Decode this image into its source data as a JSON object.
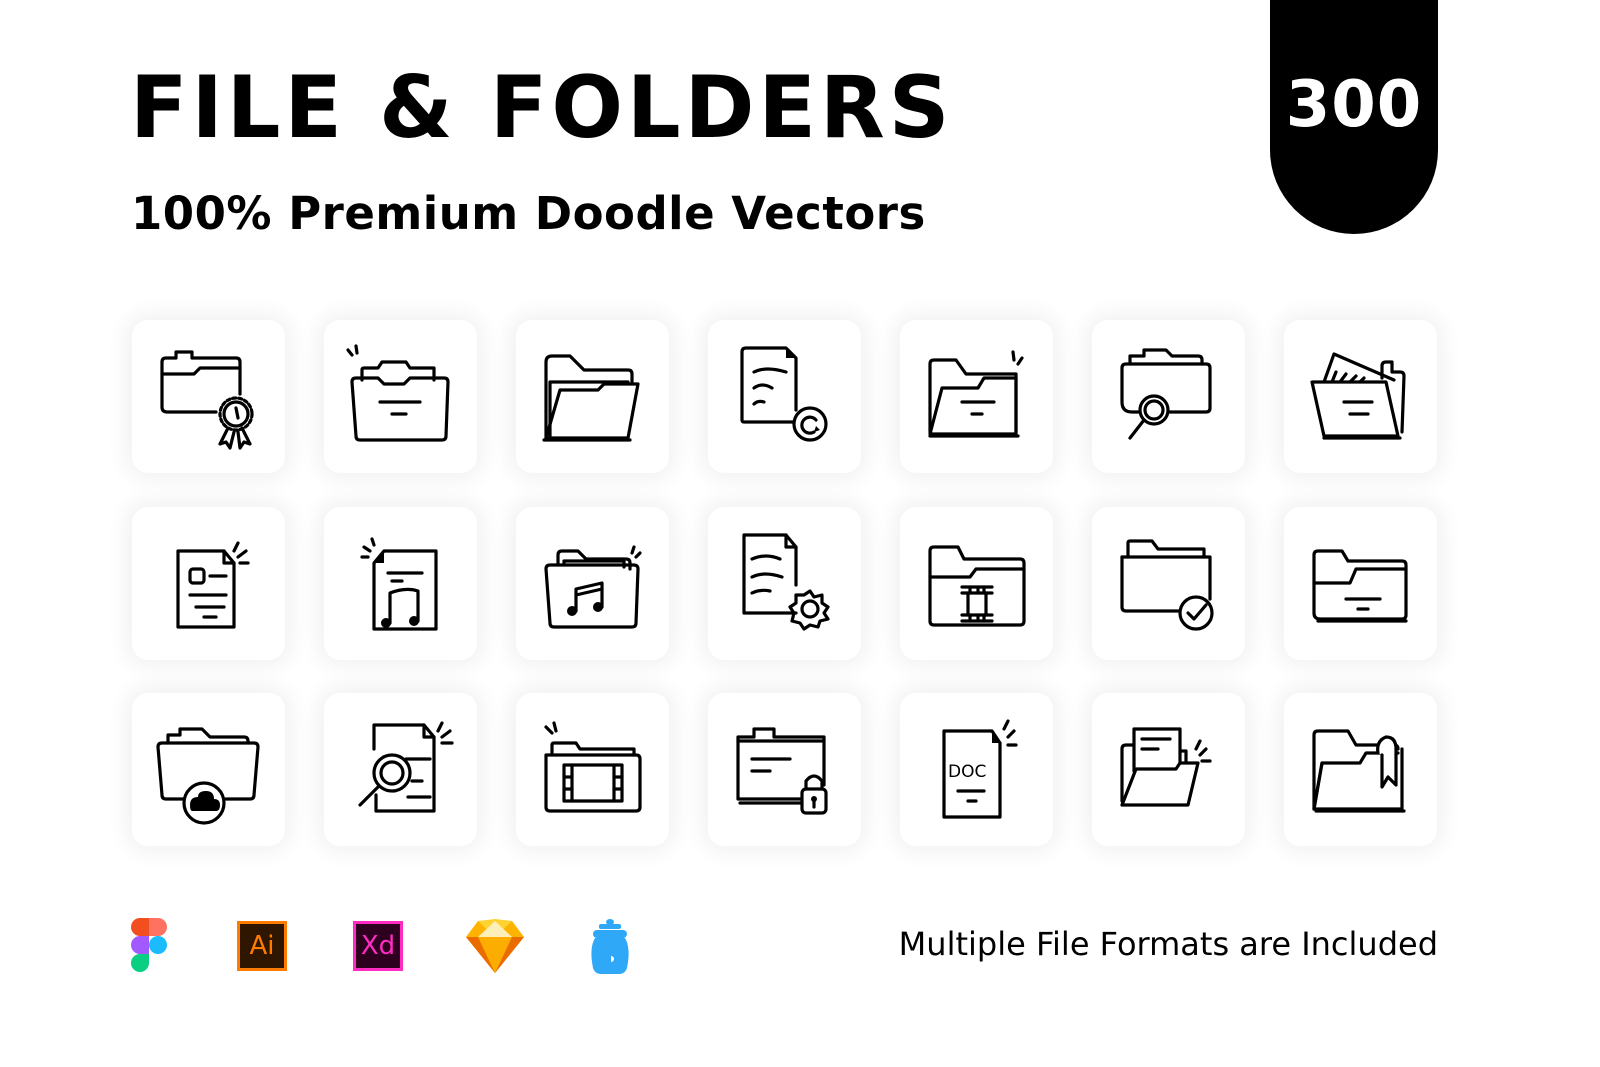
{
  "header": {
    "title": "FILE & FOLDERS",
    "subtitle": "100% Premium Doodle Vectors",
    "count_badge": "300"
  },
  "icon_grid": {
    "columns": 7,
    "rows": 3,
    "icons": [
      "folder-certificate-icon",
      "folder-open-files-icon",
      "folder-open-icon",
      "document-refresh-icon",
      "folder-open-new-icon",
      "folder-search-icon",
      "folder-open-documents-icon",
      "document-new-icon",
      "document-music-icon",
      "folder-music-icon",
      "document-settings-icon",
      "folder-film-icon",
      "folder-check-icon",
      "folder-icon",
      "folder-cloud-icon",
      "document-search-icon",
      "folder-video-icon",
      "folder-lock-icon",
      "document-doc-icon",
      "folder-documents-icon",
      "folder-bookmark-icon"
    ],
    "doc_label": "DOC"
  },
  "footer": {
    "formats": [
      {
        "name": "figma-icon",
        "label": ""
      },
      {
        "name": "illustrator-icon",
        "label": "Ai",
        "bg": "#2e1600",
        "accent": "#ff7c00"
      },
      {
        "name": "xd-icon",
        "label": "Xd",
        "bg": "#2e001f",
        "accent": "#ff2bc2"
      },
      {
        "name": "sketch-icon",
        "label": ""
      },
      {
        "name": "iconjar-icon",
        "label": ""
      }
    ],
    "tagline": "Multiple File Formats are Included"
  },
  "colors": {
    "figma": [
      "#f24e1e",
      "#ff7262",
      "#a259ff",
      "#1abcfe",
      "#0acf83"
    ],
    "sketch": [
      "#fdb300",
      "#ea6c00",
      "#fdad00",
      "#fdd231",
      "#feeeb7"
    ],
    "iconjar": "#2fa9f7"
  }
}
